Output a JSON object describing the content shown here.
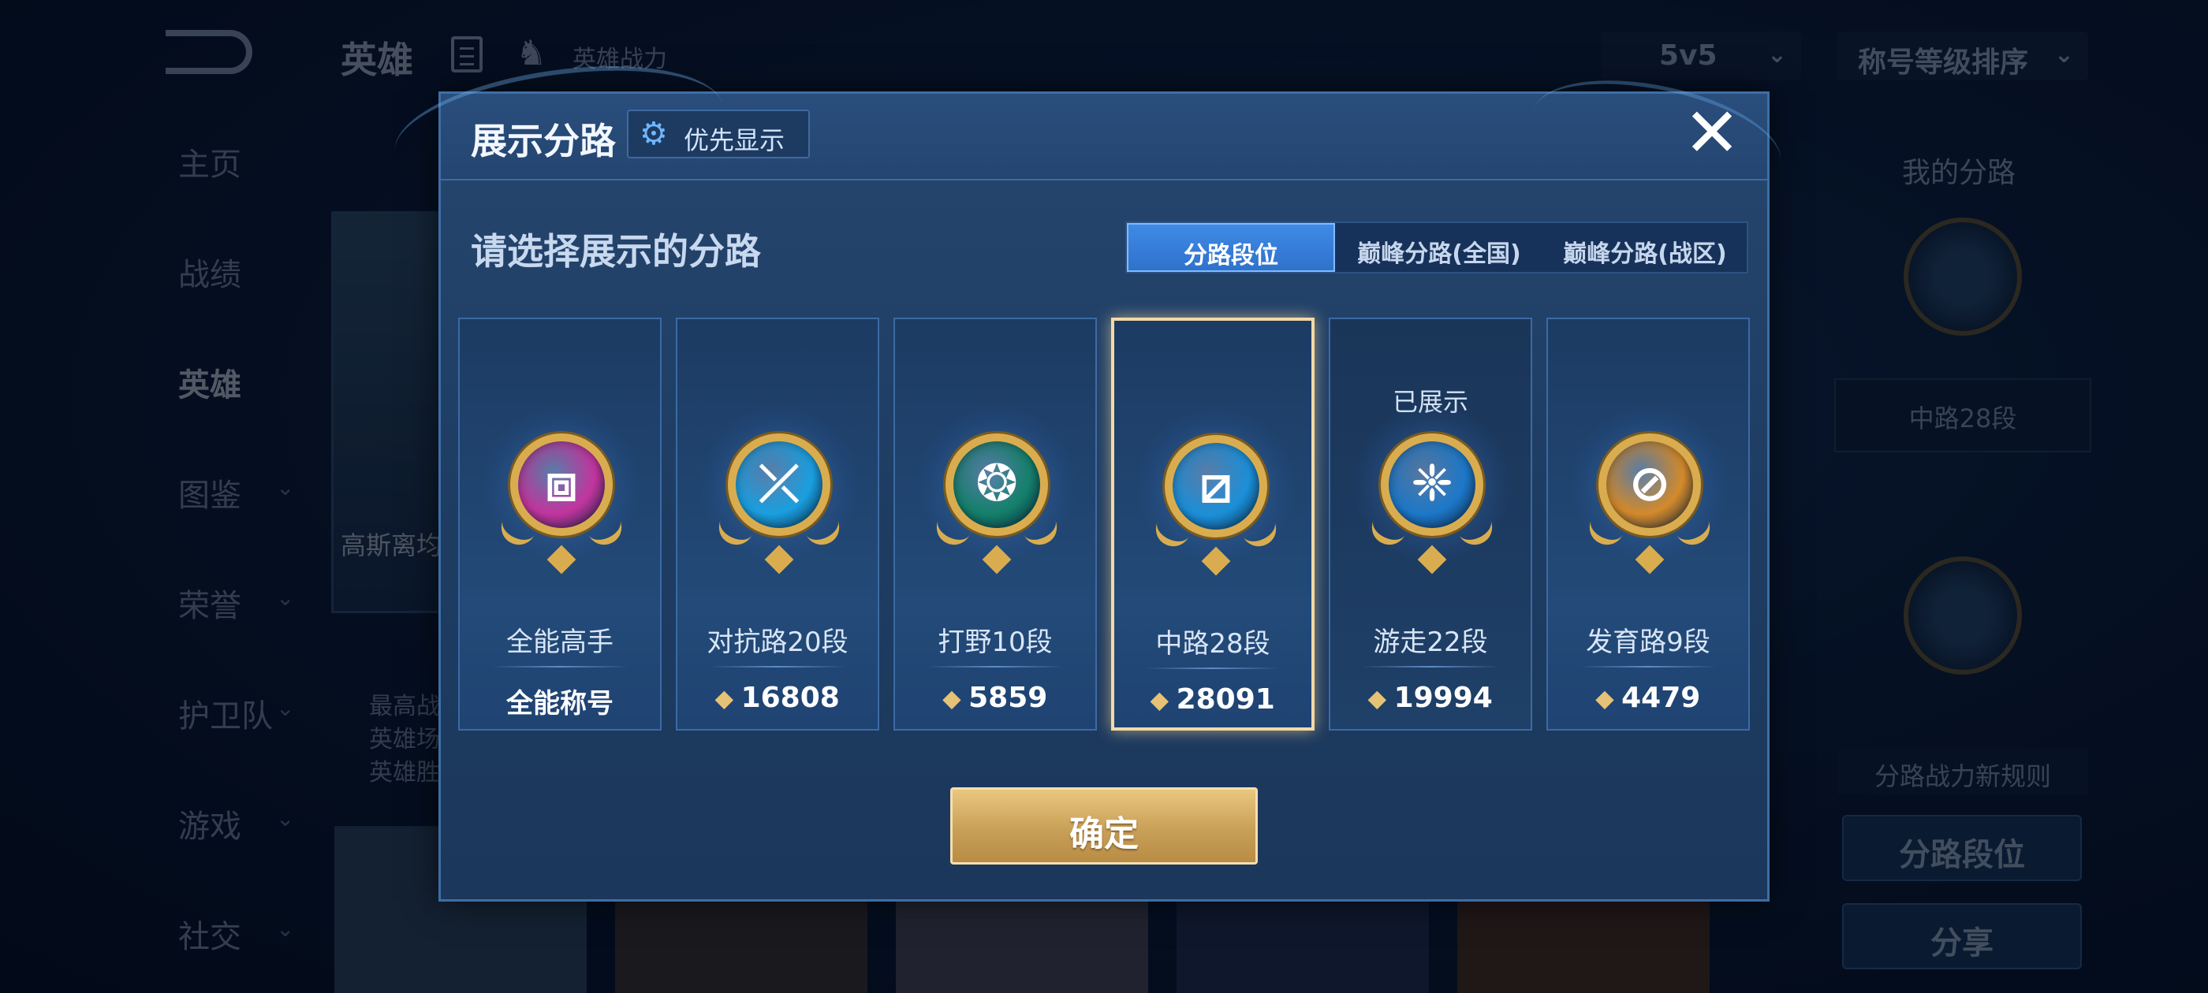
{
  "background": {
    "top_title": "英雄",
    "hero_power_label": "英雄战力",
    "mode_select": "5v5",
    "sort_select": "称号等级排序",
    "side_nav": [
      {
        "label": "主页",
        "has_chevron": false
      },
      {
        "label": "战绩",
        "has_chevron": false
      },
      {
        "label": "英雄",
        "has_chevron": false,
        "active": true
      },
      {
        "label": "图鉴",
        "has_chevron": true
      },
      {
        "label": "荣誉",
        "has_chevron": true
      },
      {
        "label": "护卫队",
        "has_chevron": true
      },
      {
        "label": "游戏",
        "has_chevron": true
      },
      {
        "label": "社交",
        "has_chevron": true
      }
    ],
    "hero_card_text": "高斯离均衡发展",
    "hero_card_desc": [
      "最高战",
      "英雄场",
      "英雄胜"
    ],
    "right_panel": {
      "title": "我的分路",
      "lane_box": "中路28段",
      "rule_text": "分路战力新规则",
      "lane_rank_button": "分路段位",
      "share_button": "分享"
    }
  },
  "dialog": {
    "title": "展示分路",
    "priority_button": "优先显示",
    "close_icon": "close-icon",
    "subtitle": "请选择展示的分路",
    "tabs": [
      {
        "label": "分路段位",
        "active": true
      },
      {
        "label": "巅峰分路(全国)",
        "active": false
      },
      {
        "label": "巅峰分路(战区)",
        "active": false
      }
    ],
    "cards": [
      {
        "name": "全能高手",
        "score": "全能称号",
        "score_is_text": true,
        "emblem_icon": "all-round-emblem-icon",
        "emblem_color": "#c2359e",
        "emblem_glyph": "⧈",
        "selected": false,
        "shown_label": ""
      },
      {
        "name": "对抗路20段",
        "score": "16808",
        "score_is_text": false,
        "emblem_icon": "clash-lane-emblem-icon",
        "emblem_color": "#1a9fe0",
        "emblem_glyph": "⤫",
        "selected": false,
        "shown_label": ""
      },
      {
        "name": "打野10段",
        "score": "5859",
        "score_is_text": false,
        "emblem_icon": "jungle-emblem-icon",
        "emblem_color": "#14806a",
        "emblem_glyph": "❂",
        "selected": false,
        "shown_label": ""
      },
      {
        "name": "中路28段",
        "score": "28091",
        "score_is_text": false,
        "emblem_icon": "mid-lane-emblem-icon",
        "emblem_color": "#1b8fd8",
        "emblem_glyph": "⧄",
        "selected": true,
        "shown_label": ""
      },
      {
        "name": "游走22段",
        "score": "19994",
        "score_is_text": false,
        "emblem_icon": "roam-emblem-icon",
        "emblem_color": "#1d78c9",
        "emblem_glyph": "❈",
        "selected": false,
        "shown_label": "已展示"
      },
      {
        "name": "发育路9段",
        "score": "4479",
        "score_is_text": false,
        "emblem_icon": "farm-lane-emblem-icon",
        "emblem_color": "#d48a2a",
        "emblem_glyph": "⊘",
        "selected": false,
        "shown_label": ""
      }
    ],
    "confirm_button": "确定"
  },
  "colors": {
    "accent_blue": "#2f72cc",
    "gold": "#d9ad4f",
    "selected_border": "#f3d9a6"
  }
}
